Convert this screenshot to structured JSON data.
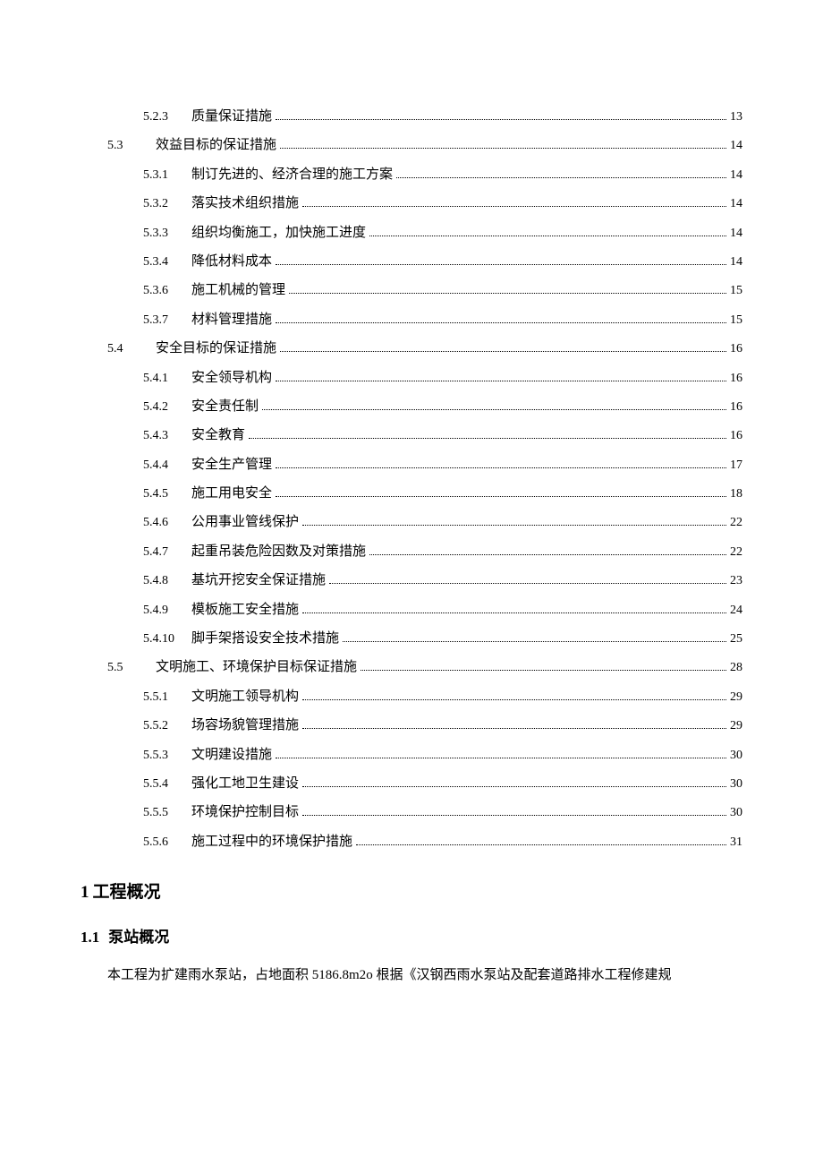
{
  "toc": [
    {
      "level": "sub",
      "num": "5.2.3",
      "title": "质量保证措施",
      "page": "13"
    },
    {
      "level": "section",
      "num": "5.3",
      "title": "效益目标的保证措施",
      "page": "14"
    },
    {
      "level": "sub",
      "num": "5.3.1",
      "title": "制订先进的、经济合理的施工方案",
      "page": "14"
    },
    {
      "level": "sub",
      "num": "5.3.2",
      "title": "落实技术组织措施",
      "page": "14"
    },
    {
      "level": "sub",
      "num": "5.3.3",
      "title": "组织均衡施工，加快施工进度",
      "page": "14"
    },
    {
      "level": "sub",
      "num": "5.3.4",
      "title": "降低材料成本",
      "page": "14"
    },
    {
      "level": "sub",
      "num": "5.3.6",
      "title": "施工机械的管理",
      "page": "15"
    },
    {
      "level": "sub",
      "num": "5.3.7",
      "title": "材料管理措施",
      "page": "15"
    },
    {
      "level": "section",
      "num": "5.4",
      "title": "安全目标的保证措施",
      "page": "16"
    },
    {
      "level": "sub",
      "num": "5.4.1",
      "title": "安全领导机构",
      "page": "16"
    },
    {
      "level": "sub",
      "num": "5.4.2",
      "title": "安全责任制",
      "page": "16"
    },
    {
      "level": "sub",
      "num": "5.4.3",
      "title": "安全教育",
      "page": "16"
    },
    {
      "level": "sub",
      "num": "5.4.4",
      "title": "安全生产管理",
      "page": "17"
    },
    {
      "level": "sub",
      "num": "5.4.5",
      "title": "施工用电安全",
      "page": "18"
    },
    {
      "level": "sub",
      "num": "5.4.6",
      "title": "公用事业管线保护",
      "page": "22"
    },
    {
      "level": "sub",
      "num": "5.4.7",
      "title": "起重吊装危险因数及对策措施",
      "page": "22"
    },
    {
      "level": "sub",
      "num": "5.4.8",
      "title": "基坑开挖安全保证措施",
      "page": "23"
    },
    {
      "level": "sub",
      "num": "5.4.9",
      "title": "模板施工安全措施",
      "page": "24"
    },
    {
      "level": "sub",
      "num": "5.4.10",
      "title": "脚手架搭设安全技术措施",
      "page": "25"
    },
    {
      "level": "section",
      "num": "5.5",
      "title": "文明施工、环境保护目标保证措施",
      "page": "28"
    },
    {
      "level": "sub",
      "num": "5.5.1",
      "title": "文明施工领导机构",
      "page": "29"
    },
    {
      "level": "sub",
      "num": "5.5.2",
      "title": "场容场貌管理措施",
      "page": "29"
    },
    {
      "level": "sub",
      "num": "5.5.3",
      "title": "文明建设措施",
      "page": "30"
    },
    {
      "level": "sub",
      "num": "5.5.4",
      "title": "强化工地卫生建设",
      "page": "30"
    },
    {
      "level": "sub",
      "num": "5.5.5",
      "title": "环境保护控制目标",
      "page": "30"
    },
    {
      "level": "sub",
      "num": "5.5.6",
      "title": "施工过程中的环境保护措施",
      "page": "31"
    }
  ],
  "section": {
    "num": "1",
    "title": "工程概况"
  },
  "subsection": {
    "num": "1.1",
    "title": "泵站概况"
  },
  "para1_prefix": "本工程为扩建雨水泵站，占地面积 ",
  "para1_area": "5186.8m2",
  "para1_suffix": "o 根据《汉钢西雨水泵站及配套道路排水工程修建规"
}
